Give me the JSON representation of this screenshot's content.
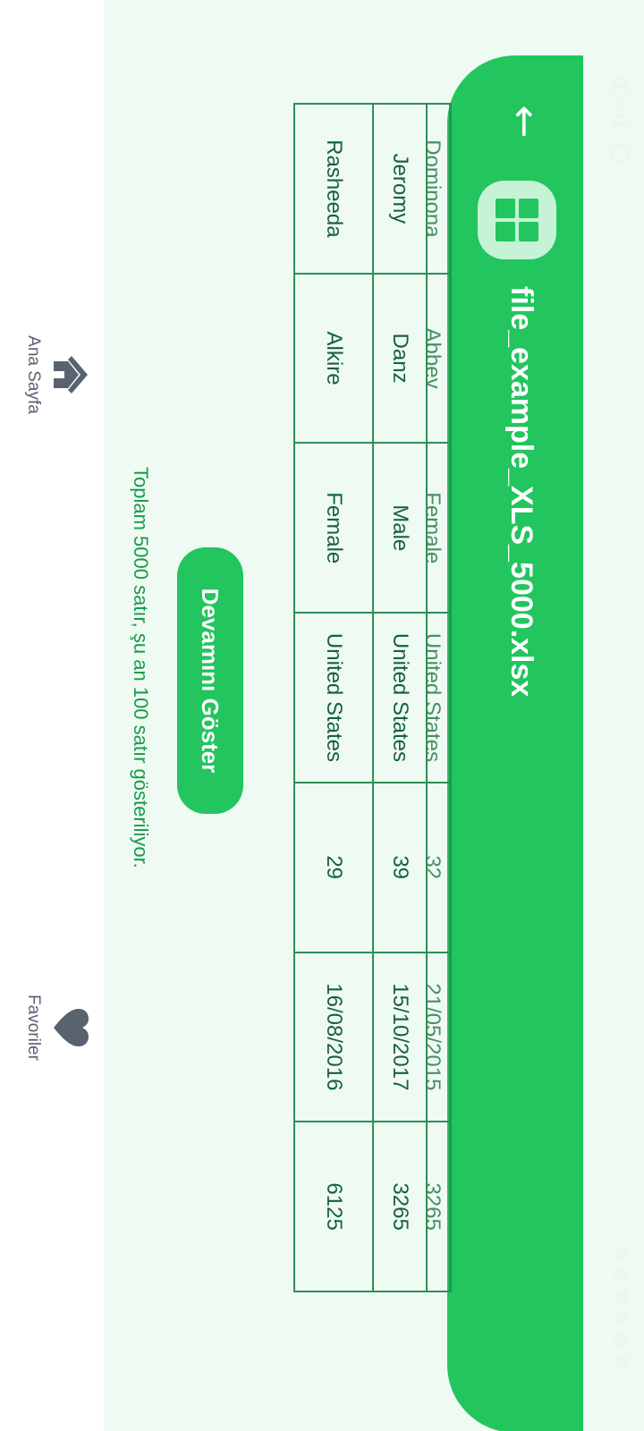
{
  "status": {
    "time": "03:01"
  },
  "header": {
    "title": "file_example_XLS_5000.xlsx",
    "back_icon": "arrow-left-icon",
    "app_icon": "grid-icon"
  },
  "table": {
    "partial_row": [
      "Dominona",
      "Abbey",
      "Female",
      "United States",
      "32",
      "21/05/2015",
      "3265"
    ],
    "rows": [
      [
        "Jeromy",
        "Danz",
        "Male",
        "United States",
        "39",
        "15/10/2017",
        "3265"
      ],
      [
        "Rasheeda",
        "Alkire",
        "Female",
        "United States",
        "29",
        "16/08/2016",
        "6125"
      ]
    ]
  },
  "actions": {
    "show_more": "Devamını Göster"
  },
  "summary": "Toplam 5000 satır, şu an 100 satır gösteriliyor.",
  "nav": {
    "home": {
      "label": "Ana Sayfa",
      "icon": "home-icon"
    },
    "favorites": {
      "label": "Favoriler",
      "icon": "heart-icon"
    }
  },
  "colors": {
    "primary": "#22c55e",
    "background": "#eefaf2",
    "text": "#17623a"
  }
}
